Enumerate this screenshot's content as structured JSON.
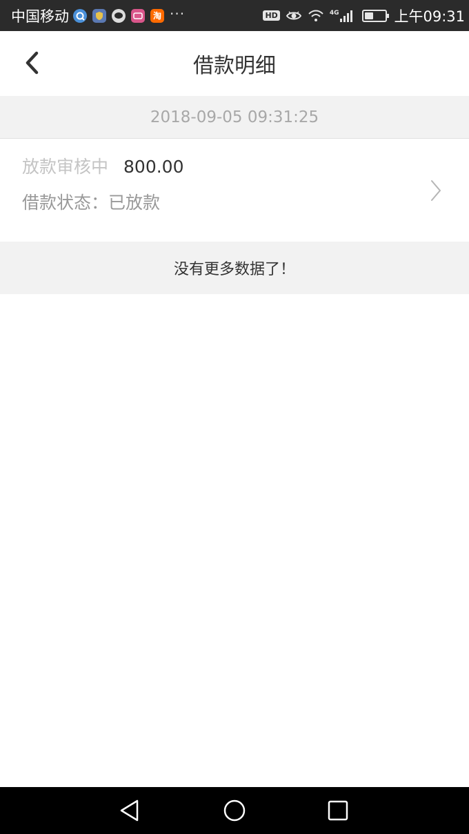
{
  "status_bar": {
    "carrier": "中国移动",
    "more": "···",
    "hd": "HD",
    "network": "4G",
    "battery_level": 0.35,
    "time": "上午09:31",
    "notification_icons": [
      "qq-browser-icon",
      "shield-app-icon",
      "chat-icon",
      "pink-app-icon",
      "taobao-icon"
    ],
    "taobao_glyph": "淘"
  },
  "header": {
    "title": "借款明细"
  },
  "loan": {
    "date": "2018-09-05 09:31:25",
    "status_label": "放款审核中",
    "amount": "800.00",
    "state_label": "借款状态：",
    "state_value": "已放款"
  },
  "list": {
    "no_more_text": "没有更多数据了！"
  },
  "colors": {
    "status_bar_bg": "#2b2b2b",
    "band_bg": "#f2f2f2",
    "text_primary": "#333333",
    "text_secondary": "#999999",
    "nav_bar_bg": "#000000"
  }
}
